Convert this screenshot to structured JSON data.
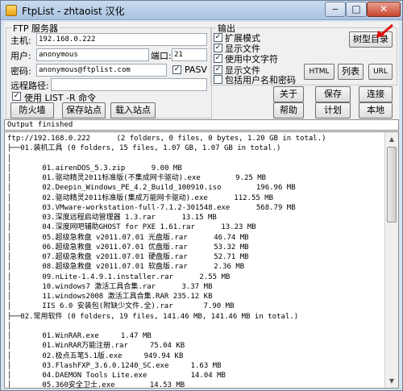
{
  "window": {
    "title": "FtpList - zhtaoist 汉化",
    "minimize": "‒",
    "maximize": "□",
    "close": "✕"
  },
  "server": {
    "group_label": "FTP 服务器",
    "host_label": "主机:",
    "host_value": "192.168.0.222",
    "user_label": "用户:",
    "user_value": "anonymous",
    "port_label": "端口:",
    "port_value": "21",
    "pass_label": "密码:",
    "pass_value": "anonymous@ftplist.com",
    "pasv_label": "PASV",
    "pasv_checked": "✓",
    "remote_path_label": "远程路径:",
    "remote_path_value": "",
    "use_list_label": "使用 LIST -R 命令",
    "use_list_checked": "✓",
    "firewall_label": "防火墙",
    "save_site_label": "保存站点",
    "load_site_label": "载入站点"
  },
  "output_opts": {
    "group_label": "输出",
    "expand_label": "扩展模式",
    "expand_checked": "✓",
    "show_files_label": "显示文件",
    "show_files_checked": "✓",
    "chinese_label": "使用中文字符",
    "chinese_checked": "✓",
    "show_files2_label": "显示文件",
    "show_files2_checked": "✓",
    "include_user_label": "包括用户名和密码",
    "include_user_checked": "",
    "tree_label": "树型目录",
    "html_label": "HTML",
    "list_label": "列表",
    "url_label": "URL"
  },
  "buttons": {
    "about": "关于",
    "save": "保存",
    "connect": "连接",
    "help": "帮助",
    "plan": "计划",
    "local": "本地"
  },
  "status": "Output finished",
  "output": [
    "ftp://192.168.0.222      (2 folders, 0 files, 0 bytes, 1.20 GB in total.)",
    "├──01.装机工具 (0 folders, 15 files, 1.07 GB, 1.07 GB in total.)",
    "│",
    "│       01.airenDOS_5.3.zip      9.00 MB",
    "│       01.驱动精灵2011标准版(不集成网卡驱动).exe        9.25 MB",
    "│       02.Deepin_Windows_PE_4.2_Build_100910.iso        196.96 MB",
    "│       02.驱动精灵2011标准版(集成万能网卡驱动).exe      112.55 MB",
    "│       03.VMware-workstation-full-7.1.2-301548.exe      568.79 MB",
    "│       03.深度远程启动管理器 1.3.rar      13.15 MB",
    "│       04.深度网吧辅助GHOST for PXE 1.61.rar      13.23 MB",
    "│       05.超级急救盘 v2011.07.01 光盘版.rar      46.74 MB",
    "│       06.超级急救盘 v2011.07.01 优盘版.rar      53.32 MB",
    "│       07.超级急救盘 v2011.07.01 硬盘版.rar      52.71 MB",
    "│       08.超级急救盘 v2011.07.01 软盘版.rar      2.36 MB",
    "│       09.nLite-1.4.9.1.installer.rar      2.55 MB",
    "│       10.windows7 激活工具合集.rar      3.37 MB",
    "│       11.windows2008 激活工具合集.RAR 235.12 KB",
    "│       IIS 6.0 安装包(附缺少文件.全).rar       7.90 MB",
    "├──02.常用软件 (0 folders, 19 files, 141.46 MB, 141.46 MB in total.)",
    "│",
    "│       01.WinRAR.exe     1.47 MB",
    "│       01.WinRAR万能注册.rar     75.04 KB",
    "│       02.极点五笔5.1版.exe     949.94 KB",
    "│       03.FlashFXP_3.6.0.1240_SC.exe     1.63 MB",
    "│       04.DAEMON Tools Lite.exe          14.04 MB",
    "│       05.360安全卫士.exe        14.53 MB"
  ],
  "scrollbar": {
    "up": "▲",
    "down": "▼"
  }
}
